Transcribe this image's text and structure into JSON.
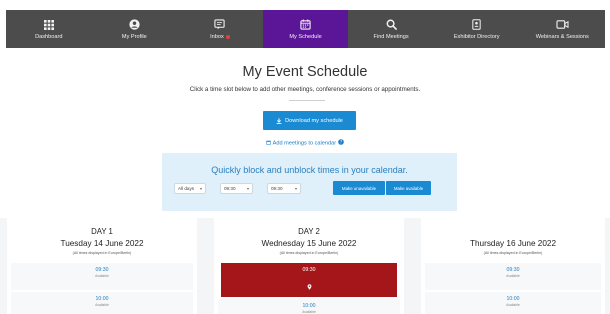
{
  "nav": {
    "items": [
      {
        "label": "Dashboard",
        "icon": "grid-icon"
      },
      {
        "label": "My Profile",
        "icon": "user-icon"
      },
      {
        "label": "Inbox",
        "icon": "inbox-icon"
      },
      {
        "label": "My Schedule",
        "icon": "calendar-icon",
        "active": true
      },
      {
        "label": "Find Meetings",
        "icon": "search-icon"
      },
      {
        "label": "Exhibitor Directory",
        "icon": "directory-icon"
      },
      {
        "label": "Webinars & Sessions",
        "icon": "video-icon"
      }
    ],
    "active_color": "#5b1697",
    "bar_color": "#4c4c4c",
    "inbox_dot_color": "#e1423a"
  },
  "header": {
    "title": "My Event Schedule",
    "subtitle": "Click a time slot below to add other meetings, conference sessions or appointments."
  },
  "download_button": {
    "label": "Download my schedule"
  },
  "calendar_link": {
    "label": "Add meetings to calendar"
  },
  "block_panel": {
    "title": "Quickly block and unblock times in your calendar.",
    "day_select": "All days",
    "from_select": "09:30",
    "to_select": "09:30",
    "block_button": "Make unavailable",
    "unblock_button": "Make available"
  },
  "days": [
    {
      "title": "DAY 1",
      "date": "Tuesday 14 June 2022",
      "tz_note": "(All times displayed in Europe/Berlin)",
      "slots": [
        {
          "time": "09:30",
          "status": "Available"
        },
        {
          "time": "10:00",
          "status": "Available"
        }
      ]
    },
    {
      "title": "DAY 2",
      "date": "Wednesday 15 June 2022",
      "tz_note": "(All times displayed in Europe/Berlin)",
      "slots": [
        {
          "time": "09:30",
          "status": "",
          "booked": true
        },
        {
          "time": "10:00",
          "status": "Available"
        }
      ]
    },
    {
      "title": "",
      "date": "Thursday 16 June 2022",
      "tz_note": "(All times displayed in Europe/Berlin)",
      "slots": [
        {
          "time": "09:30",
          "status": "Available"
        },
        {
          "time": "10:00",
          "status": "Available"
        }
      ]
    }
  ],
  "colors": {
    "accent_blue": "#1a8ad3",
    "panel_blue": "#dff0fa",
    "booked_red": "#a5161a"
  }
}
